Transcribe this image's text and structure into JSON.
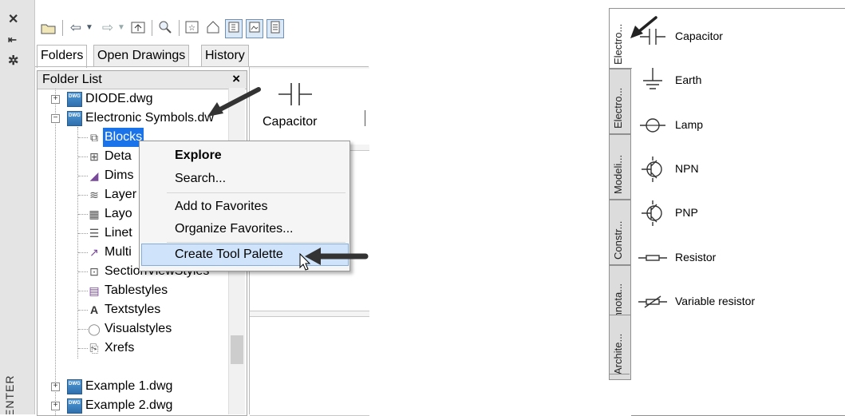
{
  "design_center": {
    "vertical_title": "ENTER",
    "strip_icons": [
      "close-icon",
      "auto-hide-icon",
      "properties-icon"
    ],
    "toolbar_icons": [
      "load-icon",
      "back-icon",
      "forward-icon",
      "up-icon",
      "search-icon",
      "favorites-icon",
      "home-icon",
      "tree-view-toggle-icon",
      "preview-icon",
      "description-icon"
    ],
    "tabs": [
      "Folders",
      "Open Drawings",
      "History"
    ],
    "active_tab": "Folders",
    "folder_list_title": "Folder List",
    "folder_list_close": "×",
    "tree": [
      {
        "label": "DIODE.dwg",
        "type": "drawing",
        "expander": "+"
      },
      {
        "label": "Electronic Symbols.dw",
        "type": "drawing",
        "expander": "−"
      },
      {
        "label": "Blocks",
        "type": "node",
        "selected": true
      },
      {
        "label": "Deta",
        "type": "node"
      },
      {
        "label": "Dims",
        "type": "node"
      },
      {
        "label": "Layer",
        "type": "node"
      },
      {
        "label": "Layo",
        "type": "node"
      },
      {
        "label": "Linet",
        "type": "node"
      },
      {
        "label": "Multi",
        "type": "node"
      },
      {
        "label": "SectionViewStyles",
        "type": "node"
      },
      {
        "label": "Tablestyles",
        "type": "node"
      },
      {
        "label": "Textstyles",
        "type": "node"
      },
      {
        "label": "Visualstyles",
        "type": "node"
      },
      {
        "label": "Xrefs",
        "type": "node"
      },
      {
        "label": "Example 1.dwg",
        "type": "drawing",
        "expander": "+"
      },
      {
        "label": "Example 2.dwg",
        "type": "drawing",
        "expander": "+"
      }
    ],
    "content_item_label": "Capacitor",
    "context_menu": {
      "items": [
        "Explore",
        "Search...",
        "Add to Favorites",
        "Organize Favorites...",
        "Create Tool Palette"
      ],
      "default_item": "Explore",
      "highlighted_item": "Create Tool Palette"
    },
    "colors": {
      "selection": "#1a73e8",
      "menu_highlight": "#cfe4fa"
    }
  },
  "tool_palette": {
    "tabs": [
      "Electro...",
      "Electro...",
      "Modeli...",
      "Constr...",
      "Annota...",
      "Archite..."
    ],
    "active_tab_index": 0,
    "items": [
      "Capacitor",
      "Earth",
      "Lamp",
      "NPN",
      "PNP",
      "Resistor",
      "Variable resistor"
    ]
  }
}
